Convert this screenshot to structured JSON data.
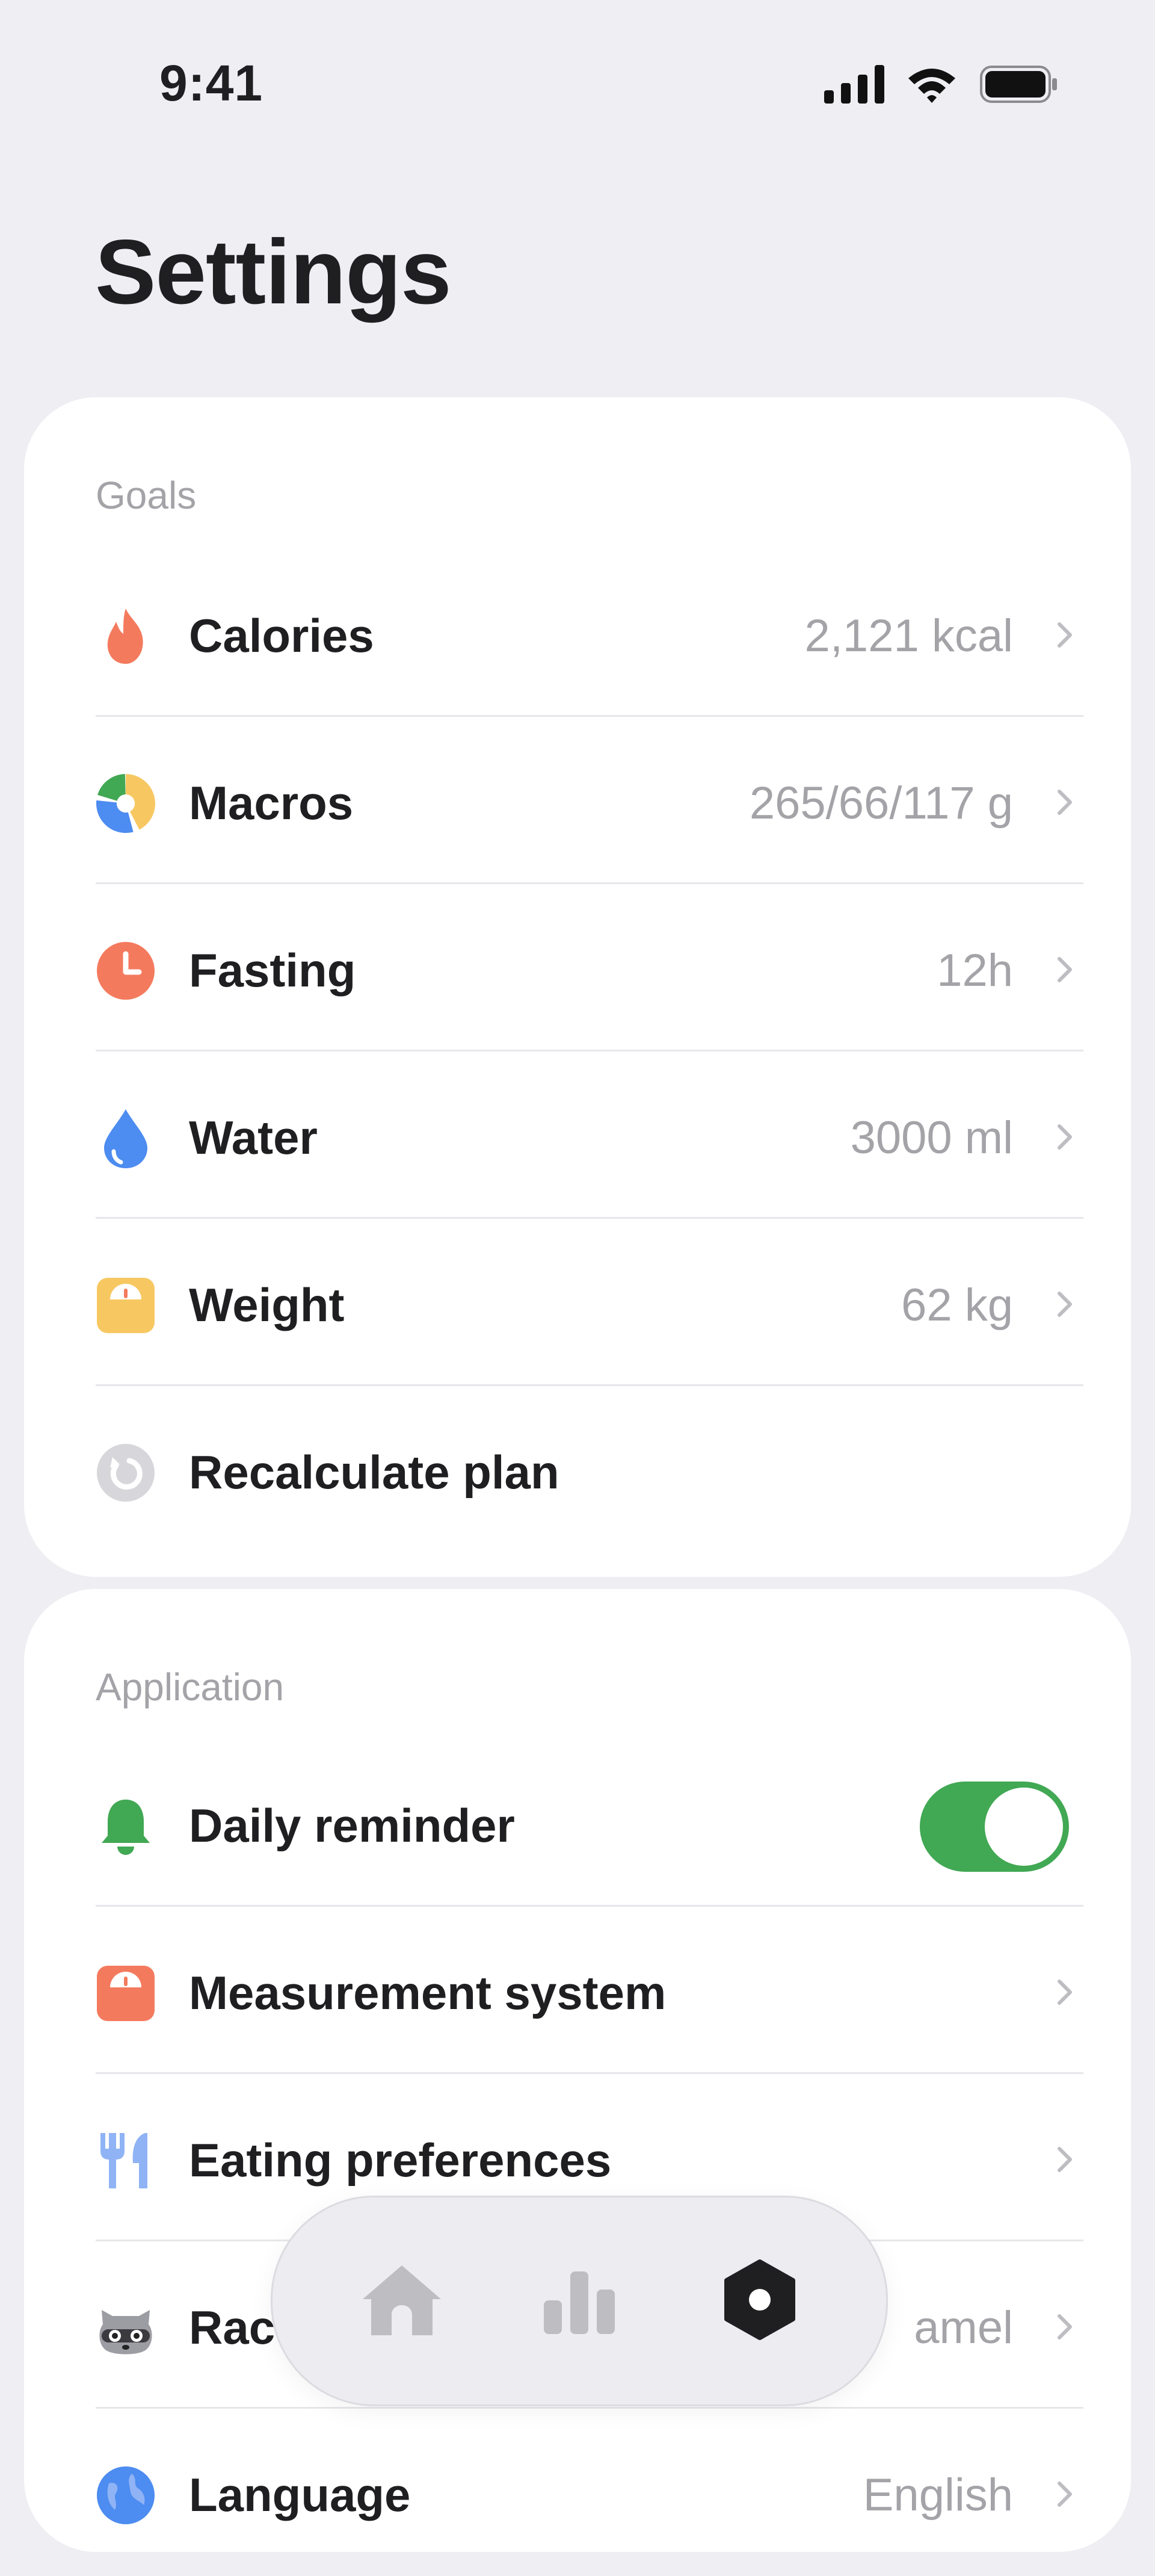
{
  "status_bar": {
    "time": "9:41"
  },
  "page": {
    "title": "Settings"
  },
  "goals": {
    "label": "Goals",
    "items": [
      {
        "label": "Calories",
        "value": "2,121 kcal",
        "icon": "flame-icon"
      },
      {
        "label": "Macros",
        "value": "265/66/117 g",
        "icon": "macros-pie-icon"
      },
      {
        "label": "Fasting",
        "value": "12h",
        "icon": "clock-icon"
      },
      {
        "label": "Water",
        "value": "3000 ml",
        "icon": "water-drop-icon"
      },
      {
        "label": "Weight",
        "value": "62 kg",
        "icon": "scale-icon"
      },
      {
        "label": "Recalculate plan",
        "icon": "refresh-icon"
      }
    ]
  },
  "application": {
    "label": "Application",
    "items": [
      {
        "label": "Daily reminder",
        "icon": "bell-icon",
        "toggle_on": true
      },
      {
        "label": "Measurement system",
        "icon": "scale-icon"
      },
      {
        "label": "Eating preferences",
        "icon": "fork-knife-icon"
      },
      {
        "label": "Rac",
        "value": "amel",
        "icon": "raccoon-icon"
      },
      {
        "label": "Language",
        "value": "English",
        "icon": "globe-icon"
      }
    ]
  },
  "tab_bar": {
    "tabs": [
      {
        "icon": "home-icon",
        "active": false
      },
      {
        "icon": "stats-icon",
        "active": false
      },
      {
        "icon": "settings-icon",
        "active": true
      }
    ]
  },
  "colors": {
    "background": "#EEEEF3",
    "card": "#FFFFFF",
    "accent_orange": "#F47A5E",
    "accent_blue": "#4D8CF0",
    "accent_yellow": "#F7C862",
    "accent_green": "#41A853",
    "text_primary": "#1F1F22",
    "text_secondary": "#A3A3A8"
  }
}
